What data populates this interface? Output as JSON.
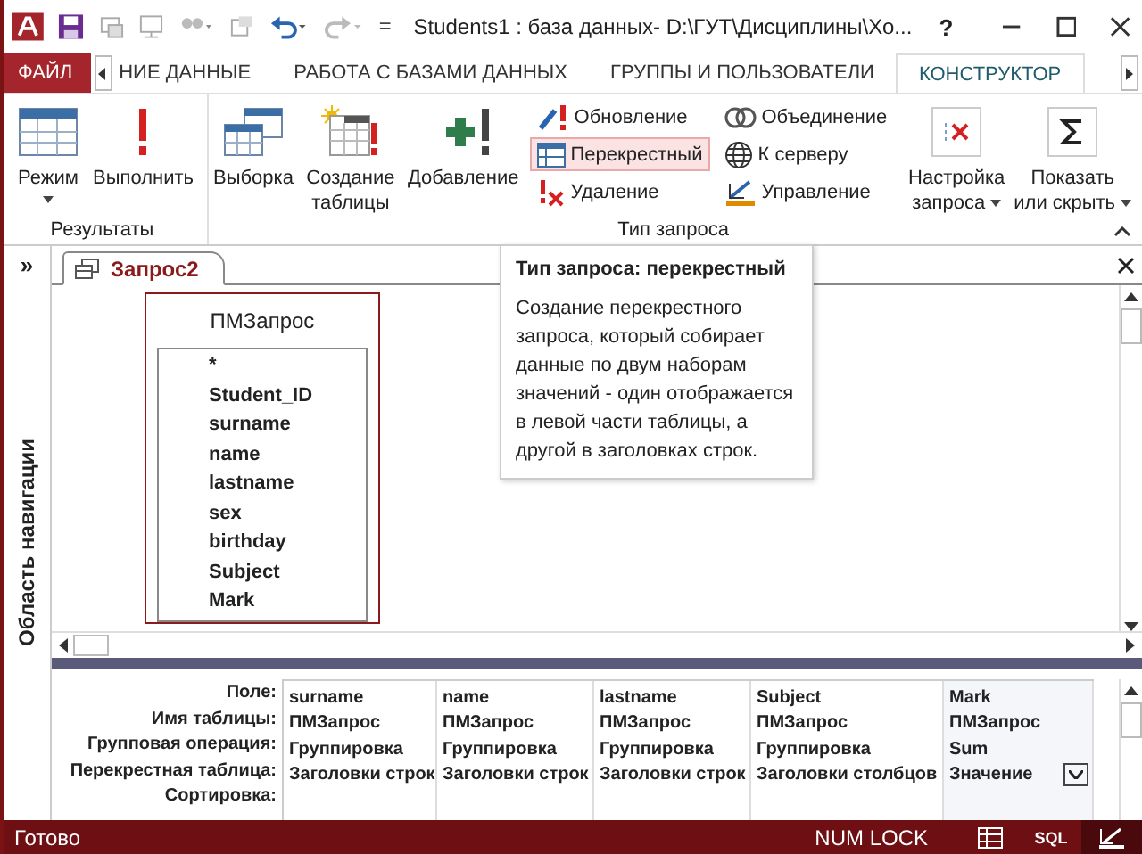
{
  "window": {
    "title": "Students1 : база данных- D:\\ГУТ\\Дисциплины\\Хо...",
    "help": "?"
  },
  "ribbon_tabs": [
    {
      "label": "ФАЙЛ",
      "kind": "file",
      "selected": false
    },
    {
      "label": "НИЕ ДАННЫЕ",
      "kind": "tab",
      "selected": false
    },
    {
      "label": "РАБОТА С БАЗАМИ ДАННЫХ",
      "kind": "tab",
      "selected": false
    },
    {
      "label": "ГРУППЫ И ПОЛЬЗОВАТЕЛИ",
      "kind": "tab",
      "selected": false
    },
    {
      "label": "КОНСТРУКТОР",
      "kind": "tab",
      "selected": true
    }
  ],
  "ribbon_groups": [
    {
      "label": "Результаты",
      "items": [
        {
          "kind": "large",
          "label": "Режим",
          "dropdown": true
        },
        {
          "kind": "large",
          "label": "Выполнить",
          "dropdown": false
        }
      ]
    },
    {
      "label": "Тип запроса",
      "items": [
        {
          "kind": "large",
          "label": "Выборка",
          "dropdown": false
        },
        {
          "kind": "large",
          "label": "Создание таблицы",
          "dropdown": false
        },
        {
          "kind": "large",
          "label": "Добавление",
          "dropdown": false
        },
        {
          "kind": "small",
          "buttons": [
            {
              "label": "Обновление",
              "selected": false
            },
            {
              "label": "Перекрестный",
              "selected": true
            },
            {
              "label": "Удаление",
              "selected": false
            }
          ]
        },
        {
          "kind": "small",
          "buttons": [
            {
              "label": "Объединение",
              "selected": false
            },
            {
              "label": "К серверу",
              "selected": false
            },
            {
              "label": "Управление",
              "selected": false
            }
          ]
        },
        {
          "kind": "large",
          "label": "Настройка запроса",
          "dropdown": true
        },
        {
          "kind": "large",
          "label": "Показать или скрыть",
          "dropdown": true
        }
      ]
    }
  ],
  "navigation_pane": {
    "toggle": "»",
    "label": "Область навигации"
  },
  "document_tab": {
    "label": "Запрос2"
  },
  "tooltip": {
    "title": "Тип запроса: перекрестный",
    "body": "Создание перекрестного запроса, который собирает данные по двум наборам значений - один отображается в левой части таблицы, а другой в заголовках строк."
  },
  "table_box": {
    "title": "ПМЗапрос",
    "fields": [
      "*",
      "Student_ID",
      "surname",
      "name",
      "lastname",
      "sex",
      "birthday",
      "Subject",
      "Mark"
    ]
  },
  "query_grid": {
    "row_labels": [
      "Поле:",
      "Имя таблицы:",
      "Групповая операция:",
      "Перекрестная таблица:",
      "Сортировка:"
    ],
    "columns": [
      {
        "field": "surname",
        "table": "ПМЗапрос",
        "total": "Группировка",
        "crosstab": "Заголовки строк",
        "active": false
      },
      {
        "field": "name",
        "table": "ПМЗапрос",
        "total": "Группировка",
        "crosstab": "Заголовки строк",
        "active": false
      },
      {
        "field": "lastname",
        "table": "ПМЗапрос",
        "total": "Группировка",
        "crosstab": "Заголовки строк",
        "active": false
      },
      {
        "field": "Subject",
        "table": "ПМЗапрос",
        "total": "Группировка",
        "crosstab": "Заголовки столбцов",
        "active": false
      },
      {
        "field": "Mark",
        "table": "ПМЗапрос",
        "total": "Sum",
        "crosstab": "Значение",
        "active": true
      }
    ]
  },
  "status_bar": {
    "text": "Готово",
    "num_lock": "NUM LOCK",
    "views": [
      {
        "kind": "datasheet",
        "selected": false
      },
      {
        "kind": "sql",
        "label": "SQL",
        "selected": false
      },
      {
        "kind": "design",
        "selected": true
      }
    ]
  }
}
